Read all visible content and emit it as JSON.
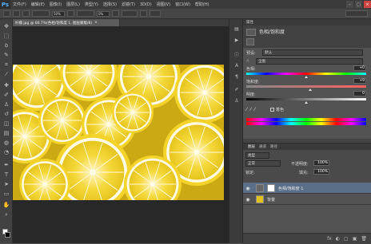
{
  "app": {
    "logo": "Ps"
  },
  "menu": [
    "文件(F)",
    "编辑(E)",
    "图像(I)",
    "图层(L)",
    "类型(Y)",
    "选择(S)",
    "滤镜(T)",
    "3D(D)",
    "视图(V)",
    "窗口(W)",
    "帮助(H)"
  ],
  "window_buttons": {
    "minimize": "–",
    "maximize": "□",
    "close": "×"
  },
  "options": {
    "flow_field": "50%",
    "size_field": "0%"
  },
  "document": {
    "tab_label": "柠檬.jpg @ 66.7%(色相/饱和度 1, 图层蒙版/8)",
    "close": "×"
  },
  "properties": {
    "header": "属性",
    "title": "色相/饱和度",
    "preset_label": "预设:",
    "preset_value": "默认",
    "channel_value": "全图",
    "hue_label": "色相:",
    "hue_value": "+0",
    "saturation_label": "饱和度:",
    "saturation_value": "+9",
    "lightness_label": "明度:",
    "lightness_value": "0",
    "colorize_label": "着色",
    "slider_levels": {
      "hue": 0.5,
      "saturation": 0.53,
      "lightness": 0.5
    }
  },
  "layers": {
    "tabs": [
      "图层",
      "通道",
      "路径"
    ],
    "kind_label": "类型",
    "blend_mode": "正常",
    "opacity_label": "不透明度:",
    "opacity_value": "100%",
    "lock_label": "锁定:",
    "fill_label": "填充:",
    "fill_value": "100%",
    "items": [
      {
        "name": "色相/饱和度 1",
        "selected": true
      },
      {
        "name": "背景",
        "selected": false
      }
    ],
    "bottom_buttons": [
      "fx",
      "◐",
      "▢",
      "▣",
      "🗑"
    ]
  },
  "colors": {
    "accent_selected_layer": "#5b6f89",
    "foreground": "#ffffff",
    "background": "#000000"
  }
}
